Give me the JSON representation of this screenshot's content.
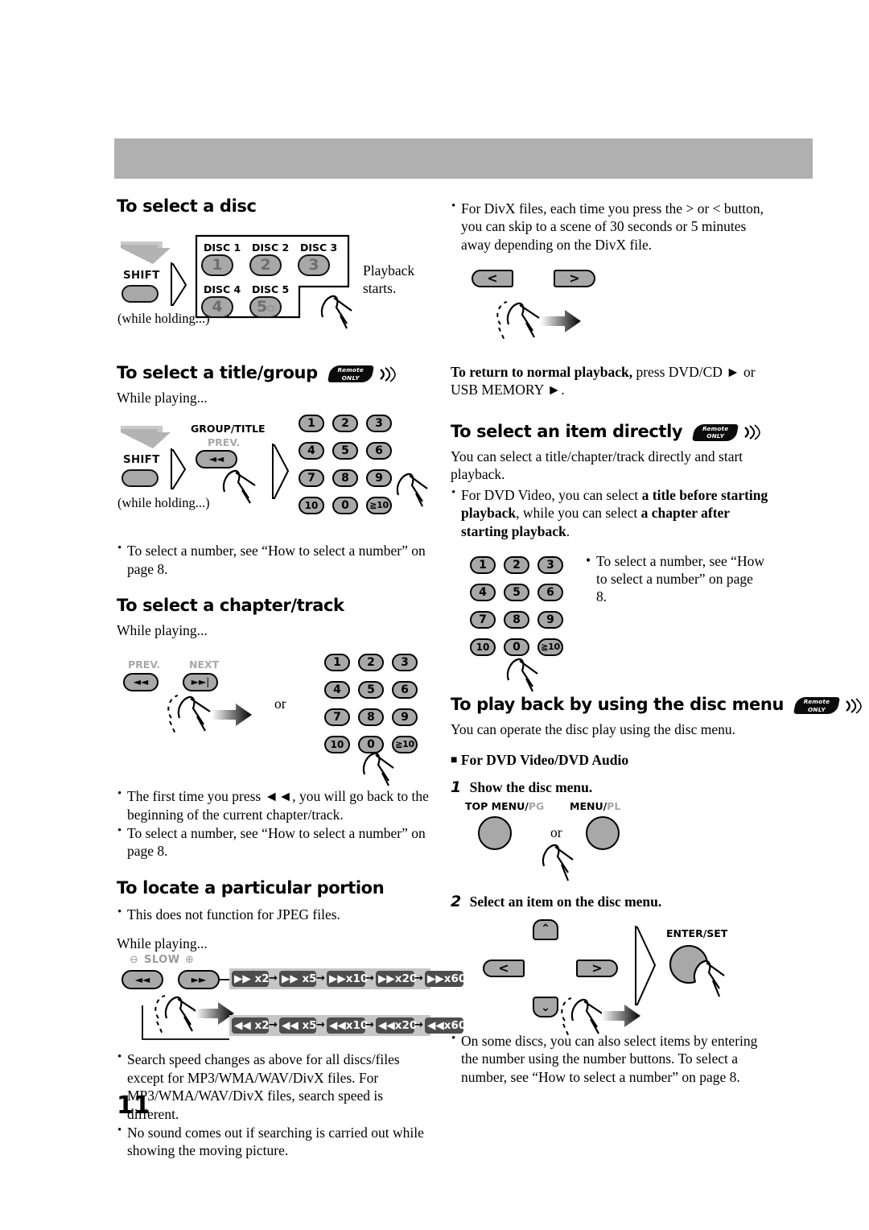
{
  "page": {
    "number": "11"
  },
  "left_column": {
    "s1": {
      "heading": "To select a disc",
      "shift_label": "SHIFT",
      "while_holding": "(while holding...)",
      "disc_labels": [
        "DISC 1",
        "DISC 2",
        "DISC 3",
        "DISC 4",
        "DISC 5"
      ],
      "disc_keys": [
        "1",
        "2",
        "3",
        "4",
        "5"
      ],
      "playback_caption_line1": "Playback",
      "playback_caption_line2": "starts."
    },
    "s2": {
      "heading": "To select a title/group",
      "badge_line1": "Remote",
      "badge_line2": "ONLY",
      "while_playing": "While playing...",
      "shift_label": "SHIFT",
      "while_holding": "(while holding...)",
      "group_title_label": "GROUP/TITLE",
      "prev_label": "PREV.",
      "keypad": [
        "1",
        "2",
        "3",
        "4",
        "5",
        "6",
        "7",
        "8",
        "9",
        "10",
        "0",
        "≧10"
      ],
      "bullets": [
        "To select a number, see “How to select a number” on page 8."
      ]
    },
    "s3": {
      "heading": "To select a chapter/track",
      "while_playing": "While playing...",
      "prev_label": "PREV.",
      "next_label": "NEXT",
      "or": "or",
      "keypad": [
        "1",
        "2",
        "3",
        "4",
        "5",
        "6",
        "7",
        "8",
        "9",
        "10",
        "0",
        "≧10"
      ],
      "bullets": [
        "The first time you press ◄◄, you will go back to the beginning of the current chapter/track.",
        "To select a number, see “How to select a number” on page 8."
      ]
    },
    "s4": {
      "heading": "To locate a particular portion",
      "bullets_top": [
        "This does not function for JPEG files."
      ],
      "while_playing": "While playing...",
      "slow_label": "SLOW",
      "slow_minus": "⊖",
      "slow_plus": "⊕",
      "forward_chips": [
        "x2",
        "x5",
        "x10",
        "x20",
        "x60"
      ],
      "reverse_chips": [
        "x2",
        "x5",
        "x10",
        "x20",
        "x60"
      ],
      "bullets_bottom": [
        "Search speed changes as above for all discs/files except for MP3/WMA/WAV/DivX files. For MP3/WMA/WAV/DivX files, search speed is different.",
        "No sound comes out if searching is carried out while showing the moving picture."
      ]
    }
  },
  "right_column": {
    "r1": {
      "bullets": [
        "For DivX files, each time you press the > or < button, you can skip to a scene of 30 seconds or 5 minutes away depending on the DivX file."
      ],
      "btn_left": "<",
      "btn_right": ">",
      "return_bold": "To return to normal playback,",
      "return_rest": " press DVD/CD ► or USB MEMORY ►."
    },
    "r2": {
      "heading": "To select an item directly",
      "badge_line1": "Remote",
      "badge_line2": "ONLY",
      "intro": "You can select a title/chapter/track directly and start playback.",
      "bullet_lead": "For DVD Video, you can select ",
      "bullet_b1": "a title before starting playback",
      "bullet_mid": ", while you can select ",
      "bullet_b2": "a chapter after starting playback",
      "bullet_end": ".",
      "keypad": [
        "1",
        "2",
        "3",
        "4",
        "5",
        "6",
        "7",
        "8",
        "9",
        "10",
        "0",
        "≧10"
      ],
      "side_note": "To select a number, see “How to select a number” on page 8."
    },
    "r3": {
      "heading": "To play back by using the disc menu",
      "badge_line1": "Remote",
      "badge_line2": "ONLY",
      "intro": "You can operate the disc play using the disc menu.",
      "subhead": "For DVD Video/DVD Audio",
      "step1_num": "1",
      "step1_title": "Show the disc menu.",
      "top_menu_label": "TOP MENU/",
      "top_menu_label_grey": "PG",
      "menu_label": "MENU/",
      "menu_label_grey": "PL",
      "or": "or",
      "step2_num": "2",
      "step2_title": "Select an item on the disc menu.",
      "btn_up": "⌃",
      "btn_down": "⌄",
      "btn_left": "<",
      "btn_right": ">",
      "enter_label": "ENTER/SET",
      "bullets": [
        "On some discs, you can also select items by entering the number using the number buttons. To select a number, see “How to select a number” on page 8."
      ]
    }
  },
  "colors": {
    "band": "#b0b0b0",
    "key_fill": "#a8a8a8",
    "chip": "#4d4d4d",
    "strip": "#c6c6c6"
  }
}
